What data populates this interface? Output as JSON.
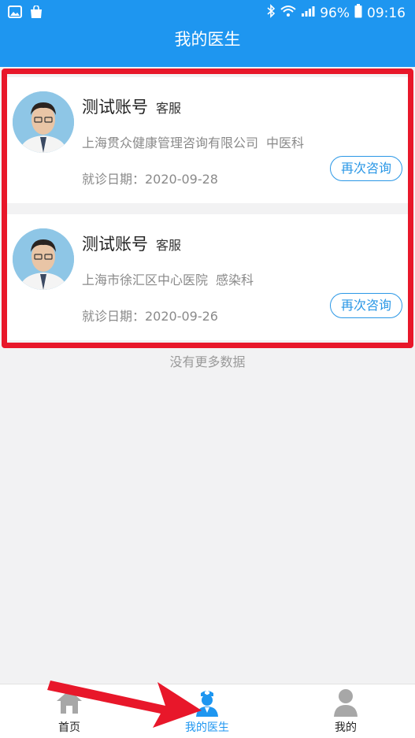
{
  "status_bar": {
    "battery": "96%",
    "time": "09:16"
  },
  "header": {
    "title": "我的医生"
  },
  "doctors": [
    {
      "name": "测试账号",
      "role": "客服",
      "hospital": "上海贯众健康管理咨询有限公司",
      "department": "中医科",
      "visit_date": "就诊日期：2020-09-28",
      "button": "再次咨询"
    },
    {
      "name": "测试账号",
      "role": "客服",
      "hospital": "上海市徐汇区中心医院",
      "department": "感染科",
      "visit_date": "就诊日期：2020-09-26",
      "button": "再次咨询"
    }
  ],
  "list_footer": "没有更多数据",
  "tabs": [
    {
      "label": "首页",
      "icon": "home-icon"
    },
    {
      "label": "我的医生",
      "icon": "nurse-icon",
      "active": true
    },
    {
      "label": "我的",
      "icon": "user-icon"
    }
  ],
  "colors": {
    "primary": "#1e96f0",
    "highlight": "#e8172a"
  }
}
